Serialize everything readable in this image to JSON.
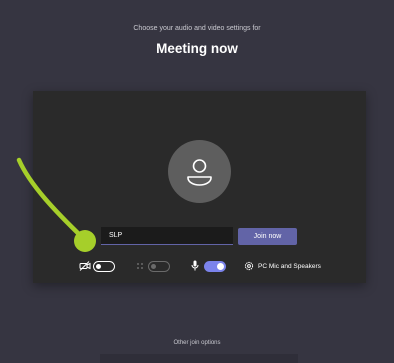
{
  "header": {
    "subtitle": "Choose your audio and video settings for",
    "meeting_title": "Meeting now"
  },
  "prejoin": {
    "name_input_value": "SLP",
    "join_button_label": "Join now",
    "camera_toggle": "off",
    "blur_toggle": "off (disabled)",
    "mic_toggle": "on",
    "audio_device_label": "PC Mic and Speakers"
  },
  "footer": {
    "other_join_options": "Other join options"
  },
  "colors": {
    "background": "#363541",
    "preview_panel": "#2a2a2a",
    "accent": "#6264a7",
    "toggle_on": "#7b83eb",
    "annotation": "#a6cf2a"
  },
  "icons": [
    "camera-off-icon",
    "background-blur-icon",
    "microphone-icon",
    "settings-gear-icon",
    "person-icon"
  ]
}
